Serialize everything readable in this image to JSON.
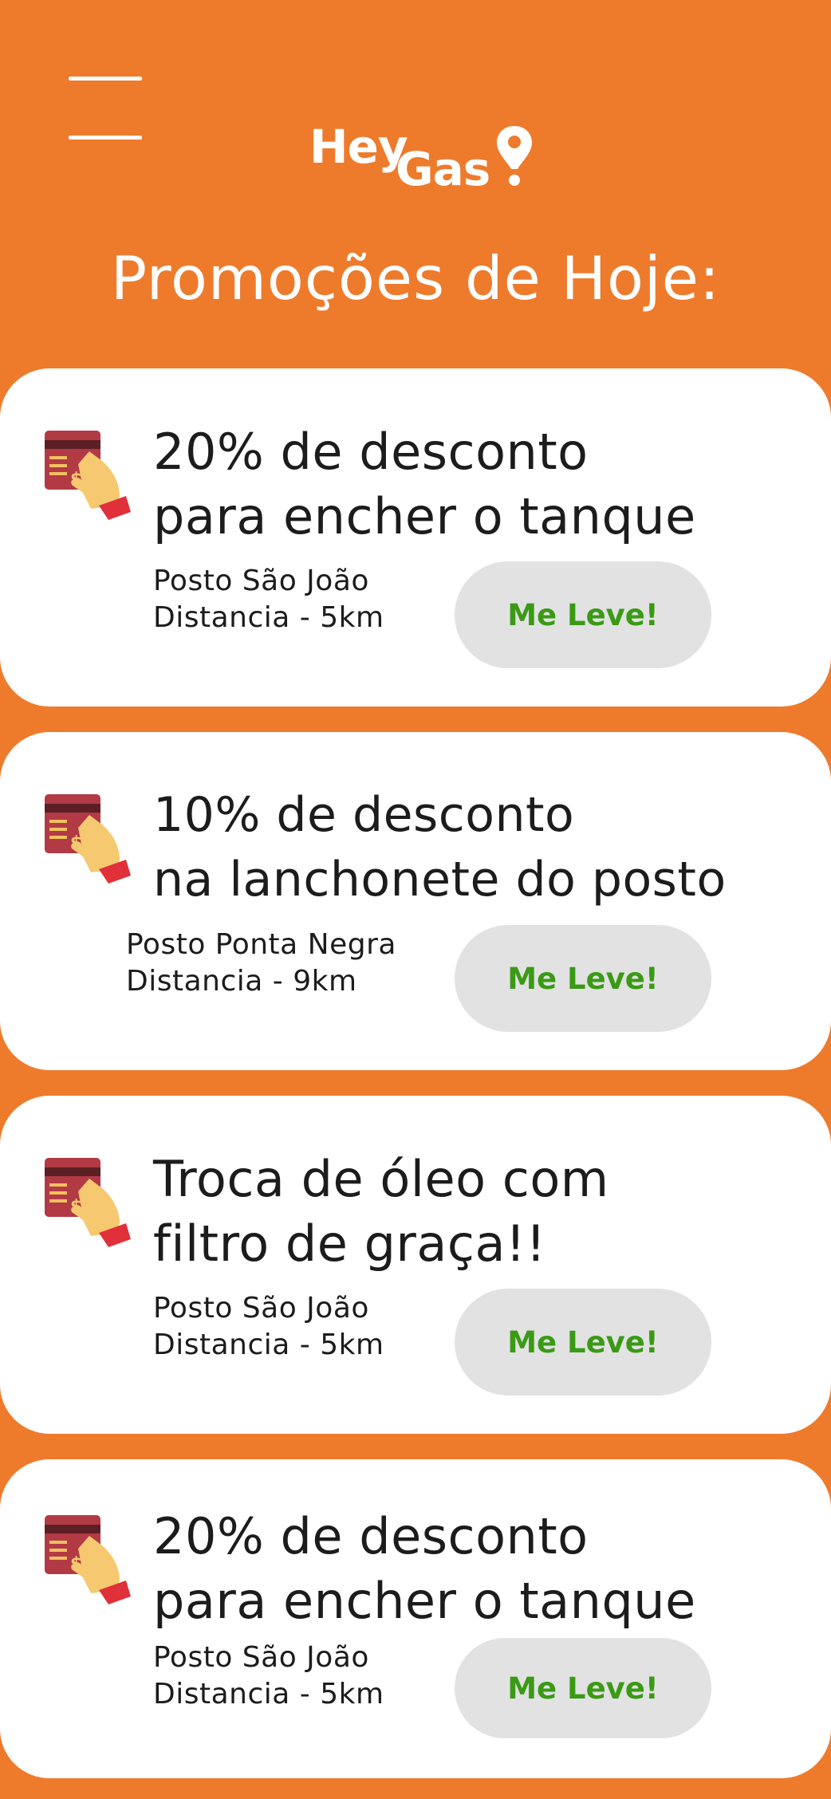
{
  "header": {
    "logo": {
      "part1": "Hey",
      "part2": "Gas"
    },
    "title": "Promoções de Hoje:"
  },
  "colors": {
    "background": "#ee7b2c",
    "card": "#ffffff",
    "button_bg": "#e2e2e2",
    "button_text": "#3a9a15"
  },
  "promotions": [
    {
      "title_line1": "20% de desconto",
      "title_line2": "para encher o tanque",
      "station": "Posto São João",
      "distance": "Distancia - 5km",
      "button_label": "Me Leve!"
    },
    {
      "title_line1": "10% de desconto",
      "title_line2": "na lanchonete do posto",
      "station": "Posto Ponta Negra",
      "distance": "Distancia - 9km",
      "button_label": "Me Leve!"
    },
    {
      "title_line1": "Troca de óleo com",
      "title_line2": "filtro de graça!!",
      "station": "Posto São João",
      "distance": "Distancia - 5km",
      "button_label": "Me Leve!"
    },
    {
      "title_line1": "20% de desconto",
      "title_line2": "para encher o tanque",
      "station": "Posto São João",
      "distance": "Distancia - 5km",
      "button_label": "Me Leve!"
    }
  ]
}
